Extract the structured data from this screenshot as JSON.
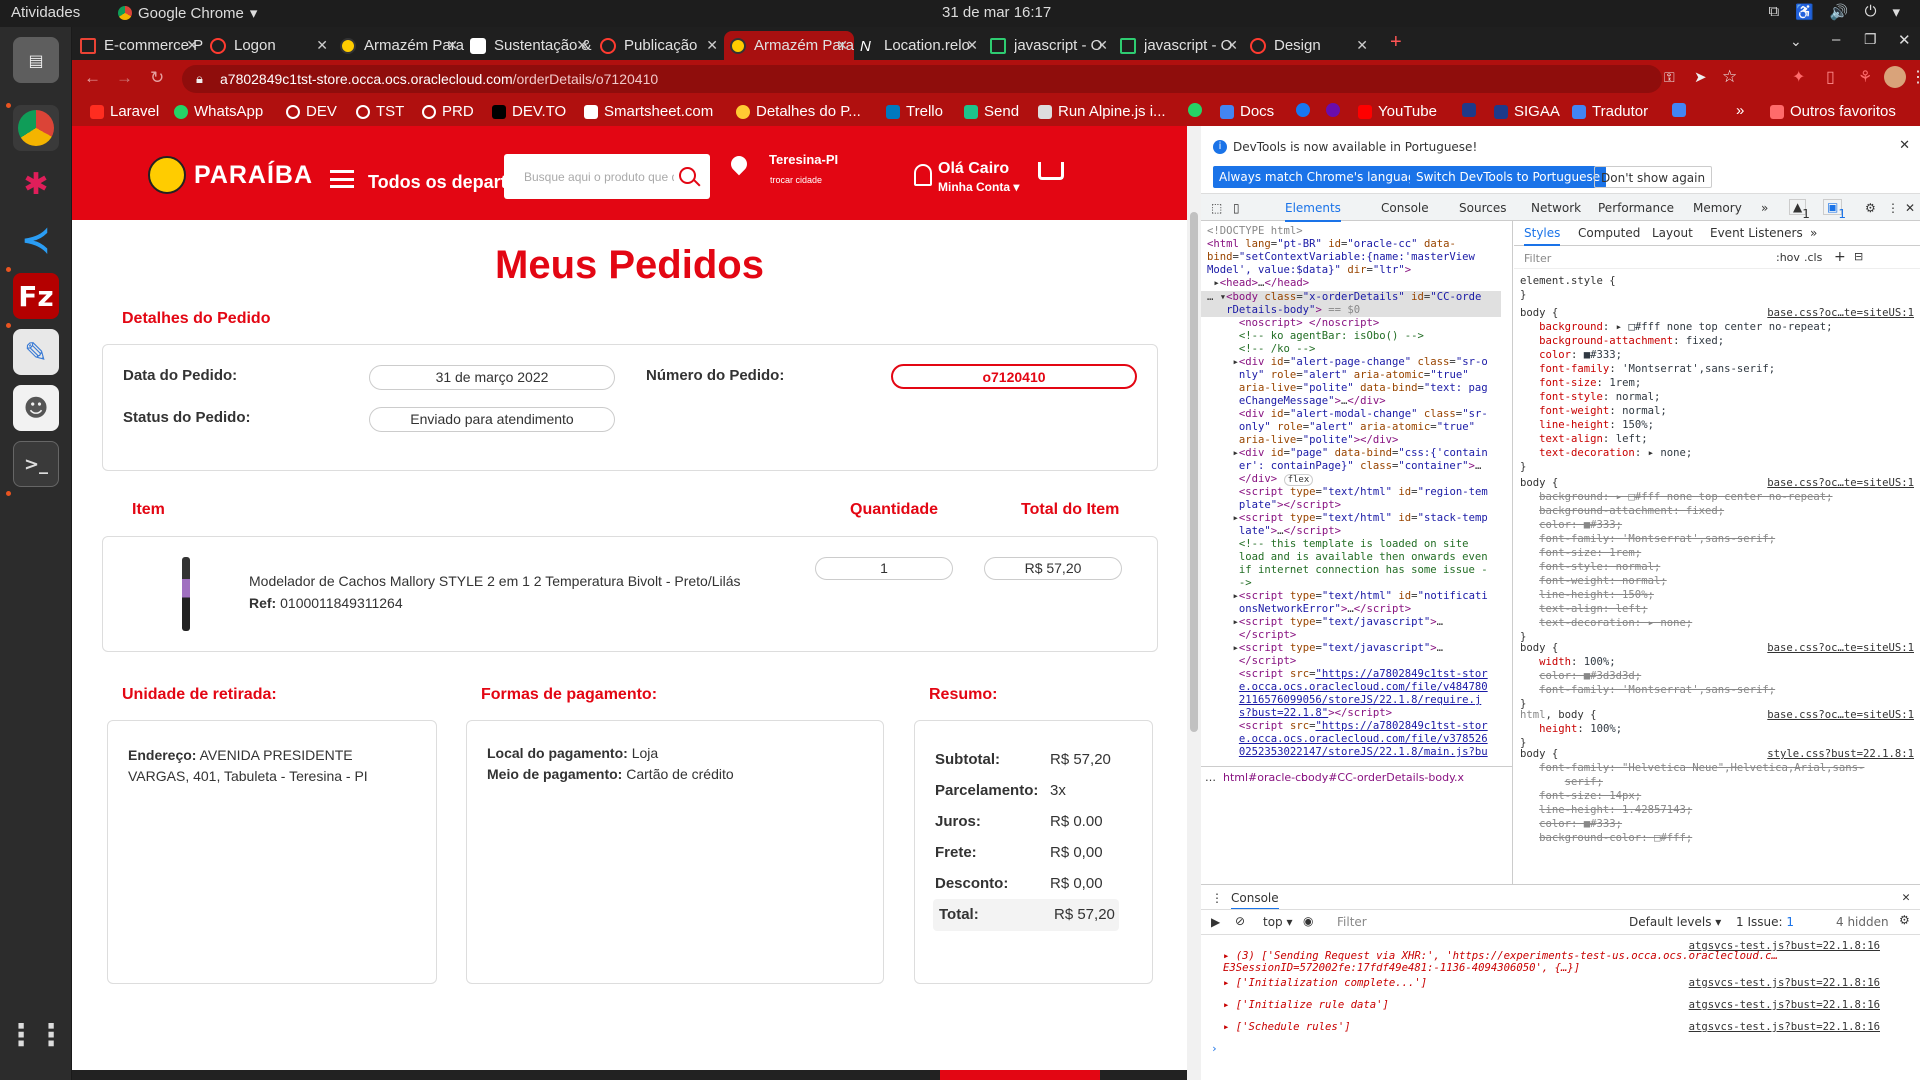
{
  "os": {
    "activities": "Atividades",
    "app_name": "Google Chrome",
    "clock": "31 de mar  16:17"
  },
  "browser": {
    "tabs": [
      {
        "label": "E-commerce P"
      },
      {
        "label": "Logon"
      },
      {
        "label": "Armazém Para"
      },
      {
        "label": "Sustentação &"
      },
      {
        "label": "Publicação"
      },
      {
        "label": "Armazém Para"
      },
      {
        "label": "Location.relo"
      },
      {
        "label": "javascript - O"
      },
      {
        "label": "javascript - O"
      },
      {
        "label": "Design"
      }
    ],
    "url_host": "a7802849c1tst-store.occa.ocs.oraclecloud.com",
    "url_path": "/orderDetails/o7120410",
    "bookmarks": [
      "Laravel",
      "WhatsApp",
      "DEV",
      "TST",
      "PRD",
      "DEV.TO",
      "Smartsheet.com",
      "Detalhes do P...",
      "Trello",
      "Send",
      "Run Alpine.js i...",
      "",
      "Docs",
      "",
      "",
      "YouTube",
      "",
      "SIGAA",
      "Tradutor",
      ""
    ],
    "bookmarks_more": "»",
    "other_bookmarks": "Outros favoritos"
  },
  "store": {
    "brand": "PARAÍBA",
    "departments": "Todos os departamentos",
    "search_placeholder": "Busque aqui o produto que deseja",
    "city": "Teresina-PI",
    "change_city": "trocar cidade",
    "greeting": "Olá Cairo",
    "account": "Minha Conta ▾"
  },
  "order": {
    "title": "Meus Pedidos",
    "details_heading": "Detalhes do Pedido",
    "date_label": "Data do Pedido:",
    "date_value": "31 de março 2022",
    "number_label": "Número do Pedido:",
    "number_value": "o7120410",
    "status_label": "Status do Pedido:",
    "status_value": "Enviado para atendimento",
    "item_header": "Item",
    "qty_header": "Quantidade",
    "total_header": "Total do Item",
    "item_name": "Modelador de Cachos Mallory STYLE 2 em 1 2 Temperatura Bivolt - Preto/Lilás",
    "item_ref_label": "Ref:",
    "item_ref": "0100011849311264",
    "item_qty": "1",
    "item_total": "R$ 57,20",
    "pickup_heading": "Unidade de retirada:",
    "address_label": "Endereço:",
    "address_value": "AVENIDA PRESIDENTE VARGAS, 401, Tabuleta - Teresina - PI",
    "payment_heading": "Formas de pagamento:",
    "pay_place_label": "Local do pagamento:",
    "pay_place_value": "Loja",
    "pay_method_label": "Meio de pagamento:",
    "pay_method_value": "Cartão de crédito",
    "summary_heading": "Resumo:",
    "summary": [
      {
        "label": "Subtotal:",
        "value": "R$ 57,20"
      },
      {
        "label": "Parcelamento:",
        "value": "3x"
      },
      {
        "label": "Juros:",
        "value": "R$ 0.00"
      },
      {
        "label": "Frete:",
        "value": "R$ 0,00"
      },
      {
        "label": "Desconto:",
        "value": "R$ 0,00"
      }
    ],
    "total_label": "Total:",
    "total_value": "R$ 57,20"
  },
  "devtools": {
    "info": "DevTools is now available in Portuguese!",
    "btn_match": "Always match Chrome's language",
    "btn_switch": "Switch DevTools to Portuguese",
    "btn_dont": "Don't show again",
    "tabs": [
      "Elements",
      "Console",
      "Sources",
      "Network",
      "Performance",
      "Memory"
    ],
    "warn_count": "1",
    "msg_count": "1",
    "styles_tabs": [
      "Styles",
      "Computed",
      "Layout",
      "Event Listeners"
    ],
    "filter": "Filter",
    "hov": ":hov",
    "cls": ".cls",
    "breadcrumb1": "html#oracle-cc",
    "breadcrumb2": "body#CC-orderDetails-body.x",
    "console_title": "Console",
    "context": "top",
    "console_filter": "Filter",
    "levels": "Default levels",
    "issues": "1 Issue:",
    "issues_count": "1",
    "hidden": "4 hidden",
    "log_src": "atgsvcs-test.js?bust=22.1.8:16",
    "logs": [
      "(3) ['Sending Request via XHR:', 'https://experiments-test-us.occa.ocs.oraclecloud.c…E3SessionID=572002fe:17fdf49e481:-1136-4094306050', {…}]",
      "['Initialization complete...']",
      "['Initialize rule data']",
      "['Schedule rules']"
    ]
  },
  "colors": {
    "brand_red": "#e30613",
    "chrome_red": "#b0100f"
  }
}
